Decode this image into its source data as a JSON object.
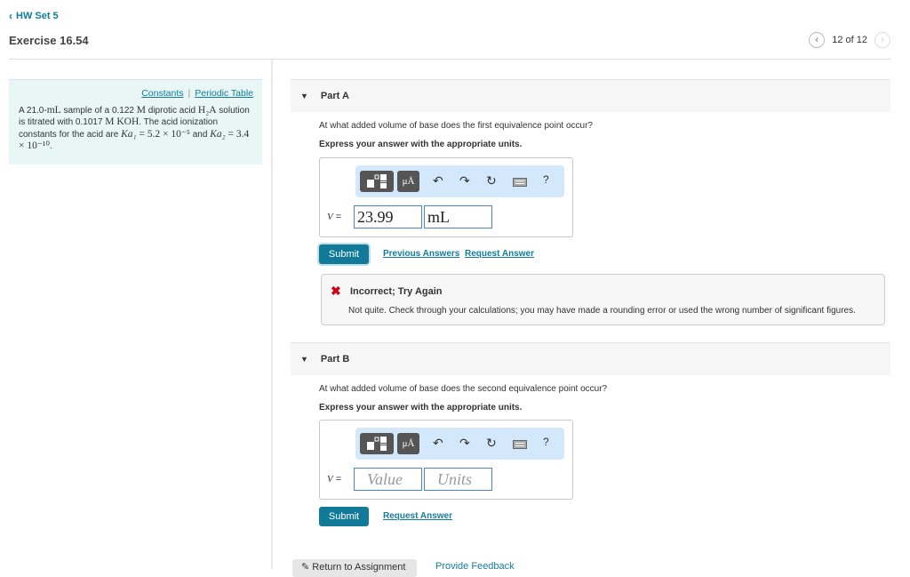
{
  "header": {
    "back_label": "HW Set 5",
    "title": "Exercise 16.54",
    "pager": "12 of 12"
  },
  "context": {
    "links": [
      "Constants",
      "Periodic Table"
    ],
    "problem_parts": {
      "p1": "A 21.0-",
      "p1_unit": "mL",
      "p2": " sample of a 0.122 ",
      "p2_unit": "M",
      "p3": " diprotic acid ",
      "acid": "H₂A",
      "p4": " solution is titrated with 0.1017 ",
      "p4_unit": "M KOH",
      "p5": ". The acid ionization constants for the acid are ",
      "ka1_label": "Ka₁",
      "ka1_value": " = 5.2 × 10⁻⁵",
      "p6": " and ",
      "ka2_label": "Ka₂",
      "ka2_value": " = 3.4 × 10⁻¹⁰",
      "p7": "."
    }
  },
  "parts": [
    {
      "title": "Part A",
      "question": "At what added volume of base does the first equivalence point occur?",
      "instruction": "Express your answer with the appropriate units.",
      "variable": "V",
      "value": "23.99",
      "units": "mL",
      "value_placeholder": "Value",
      "units_placeholder": "Units",
      "submit_label": "Submit",
      "links": [
        "Previous Answers",
        "Request Answer"
      ],
      "feedback": {
        "status": "incorrect",
        "title": "Incorrect; Try Again",
        "message": "Not quite. Check through your calculations; you may have made a rounding error or used the wrong number of significant figures."
      }
    },
    {
      "title": "Part B",
      "question": "At what added volume of base does the second equivalence point occur?",
      "instruction": "Express your answer with the appropriate units.",
      "variable": "V",
      "value": "",
      "units": "",
      "value_placeholder": "Value",
      "units_placeholder": "Units",
      "submit_label": "Submit",
      "links": [
        "Request Answer"
      ]
    }
  ],
  "toolbar": {
    "units_label": "μÅ",
    "help_label": "?"
  },
  "footer": {
    "return_label": "Return to Assignment",
    "feedback_label": "Provide Feedback"
  },
  "colors": {
    "accent": "#107a98",
    "link": "#137d9b",
    "error": "#d0021b",
    "context_bg": "#e8f6f6",
    "toolbar_bg": "#d3e8fb"
  }
}
